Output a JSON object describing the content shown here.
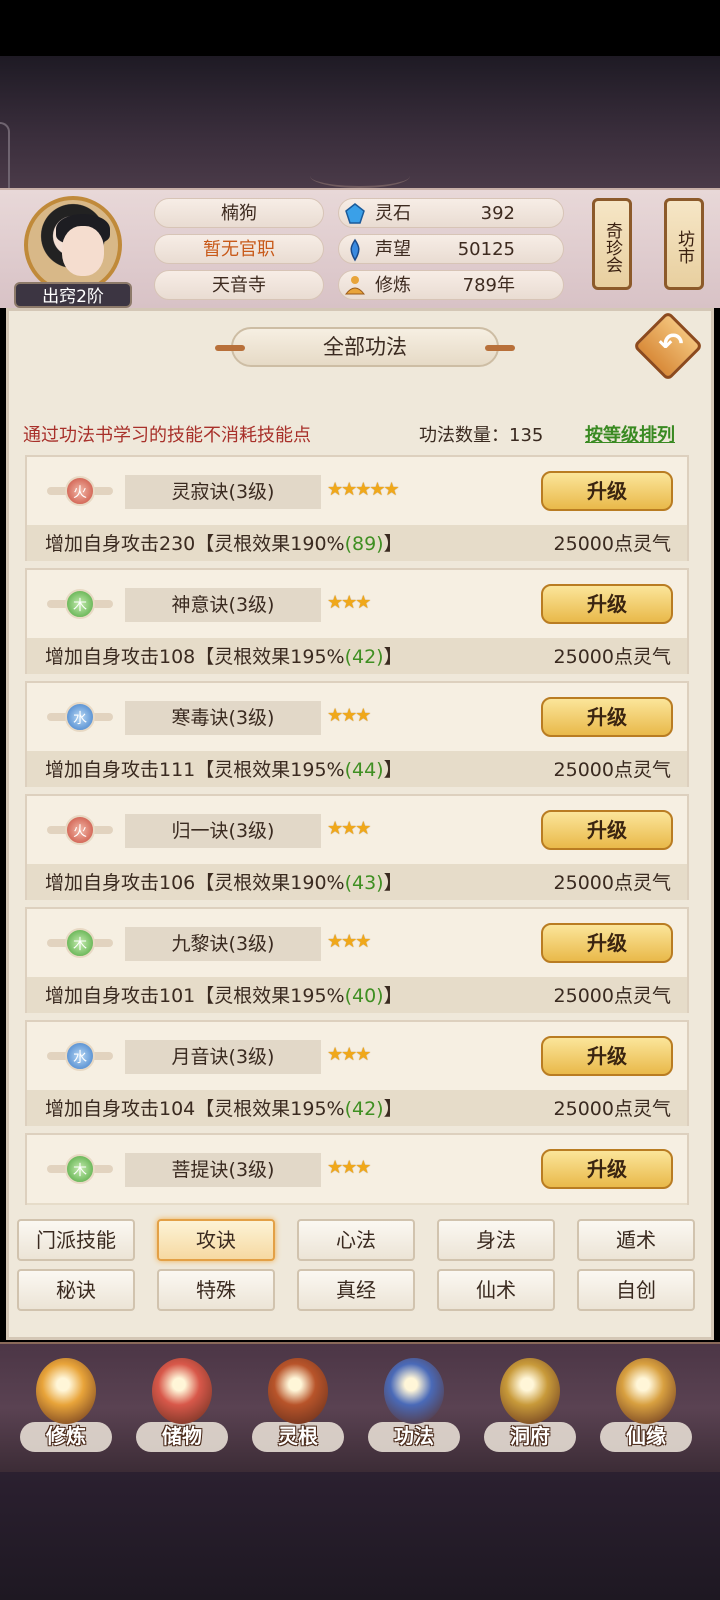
{
  "player": {
    "name": "楠狗",
    "official_title": "暂无官职",
    "sect": "天音寺",
    "rank": "出窍2阶"
  },
  "resources": [
    {
      "icon": "spirit-stone-icon",
      "label": "灵石",
      "value": "392"
    },
    {
      "icon": "reputation-icon",
      "label": "声望",
      "value": "50125"
    },
    {
      "icon": "cultivation-icon",
      "label": "修炼",
      "value": "789年"
    }
  ],
  "side_buttons": {
    "treasure_fair": "奇珍会",
    "market": "坊市"
  },
  "panel": {
    "title": "全部功法",
    "hint": "通过功法书学习的技能不消耗技能点",
    "count_label": "功法数量：135",
    "sort_label": "按等级排列"
  },
  "skills": [
    {
      "element": "火",
      "element_class": "fire",
      "name": "灵寂诀(3级)",
      "stars": "★★★★★",
      "button": "升级",
      "effect_prefix": "增加自身攻击230【灵根效果190%",
      "effect_bonus": "(89)",
      "effect_suffix": "】",
      "cost": "25000点灵气"
    },
    {
      "element": "木",
      "element_class": "wood",
      "name": "神意诀(3级)",
      "stars": "★★★",
      "button": "升级",
      "effect_prefix": "增加自身攻击108【灵根效果195%",
      "effect_bonus": "(42)",
      "effect_suffix": "】",
      "cost": "25000点灵气"
    },
    {
      "element": "水",
      "element_class": "water",
      "name": "寒毒诀(3级)",
      "stars": "★★★",
      "button": "升级",
      "effect_prefix": "增加自身攻击111【灵根效果195%",
      "effect_bonus": "(44)",
      "effect_suffix": "】",
      "cost": "25000点灵气"
    },
    {
      "element": "火",
      "element_class": "fire",
      "name": "归一诀(3级)",
      "stars": "★★★",
      "button": "升级",
      "effect_prefix": "增加自身攻击106【灵根效果190%",
      "effect_bonus": "(43)",
      "effect_suffix": "】",
      "cost": "25000点灵气"
    },
    {
      "element": "木",
      "element_class": "wood",
      "name": "九黎诀(3级)",
      "stars": "★★★",
      "button": "升级",
      "effect_prefix": "增加自身攻击101【灵根效果195%",
      "effect_bonus": "(40)",
      "effect_suffix": "】",
      "cost": "25000点灵气"
    },
    {
      "element": "水",
      "element_class": "water",
      "name": "月音诀(3级)",
      "stars": "★★★",
      "button": "升级",
      "effect_prefix": "增加自身攻击104【灵根效果195%",
      "effect_bonus": "(42)",
      "effect_suffix": "】",
      "cost": "25000点灵气"
    },
    {
      "element": "木",
      "element_class": "wood",
      "name": "菩提诀(3级)",
      "stars": "★★★",
      "button": "升级",
      "effect_prefix": "",
      "effect_bonus": "",
      "effect_suffix": "",
      "cost": ""
    }
  ],
  "category_tabs": [
    {
      "label": "门派技能",
      "active": false
    },
    {
      "label": "攻诀",
      "active": true
    },
    {
      "label": "心法",
      "active": false
    },
    {
      "label": "身法",
      "active": false
    },
    {
      "label": "遁术",
      "active": false
    },
    {
      "label": "秘诀",
      "active": false
    },
    {
      "label": "特殊",
      "active": false
    },
    {
      "label": "真经",
      "active": false
    },
    {
      "label": "仙术",
      "active": false
    },
    {
      "label": "自创",
      "active": false
    }
  ],
  "bottom_nav": [
    {
      "label": "修炼",
      "icon": "meditation-icon",
      "color": "#e8a43a"
    },
    {
      "label": "储物",
      "icon": "bag-icon",
      "color": "#d8584a"
    },
    {
      "label": "灵根",
      "icon": "spirit-root-icon",
      "color": "#b8542a"
    },
    {
      "label": "功法",
      "icon": "book-icon",
      "color": "#4a6ab8"
    },
    {
      "label": "洞府",
      "icon": "cave-house-icon",
      "color": "#c89a3a"
    },
    {
      "label": "仙缘",
      "icon": "gourd-icon",
      "color": "#d8a040"
    }
  ]
}
